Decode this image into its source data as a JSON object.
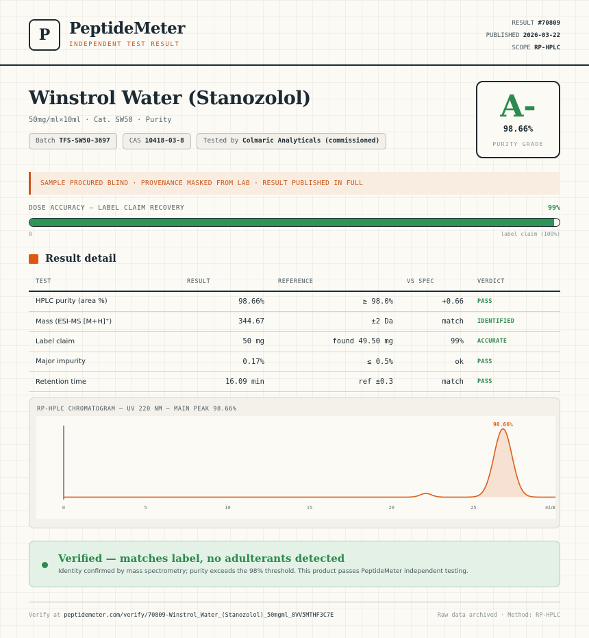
{
  "brand": {
    "logo_letter": "P",
    "name": "PeptideMeter",
    "tagline": "INDEPENDENT TEST RESULT"
  },
  "meta": {
    "result_label": "RESULT",
    "result_value": "#70809",
    "published_label": "PUBLISHED",
    "published_value": "2026-03-22",
    "scope_label": "SCOPE",
    "scope_value": "RP-HPLC"
  },
  "product": {
    "title": "Winstrol Water (Stanozolol)",
    "subtitle": "50mg/ml×10ml · Cat. SW50 · Purity",
    "chips": [
      {
        "label": "Batch",
        "value": "TFS-SW50-3697"
      },
      {
        "label": "CAS",
        "value": "10418-03-8"
      },
      {
        "label": "Tested by",
        "value": "Colmaric Analyticals (commissioned)"
      }
    ]
  },
  "grade": {
    "letter": "A-",
    "value": "98.66%",
    "label": "PURITY GRADE",
    "color": "#2d8a4e"
  },
  "banner": {
    "text": "SAMPLE PROCURED BLIND · PROVENANCE MASKED FROM LAB · RESULT PUBLISHED IN FULL",
    "color": "#c8561b"
  },
  "dose": {
    "label": "DOSE ACCURACY — LABEL CLAIM RECOVERY",
    "percent_text": "99%",
    "fill_fraction": 0.99,
    "min_label": "0",
    "max_label": "label claim (100%)"
  },
  "detail": {
    "title": "Result detail",
    "columns": [
      "TEST",
      "RESULT",
      "REFERENCE",
      "VS SPEC",
      "VERDICT"
    ],
    "rows": [
      {
        "test": "HPLC purity (area %)",
        "result": "98.66%",
        "reference": "≥ 98.0%",
        "vs_spec": "+0.66",
        "verdict": "PASS"
      },
      {
        "test": "Mass (ESI-MS [M+H]⁺)",
        "result": "344.67",
        "reference": "±2 Da",
        "vs_spec": "match",
        "verdict": "IDENTIFIED"
      },
      {
        "test": "Label claim",
        "result": "50 mg",
        "reference": "found 49.50 mg",
        "vs_spec": "99%",
        "verdict": "ACCURATE"
      },
      {
        "test": "Major impurity",
        "result": "0.17%",
        "reference": "≤ 0.5%",
        "vs_spec": "ok",
        "verdict": "PASS"
      },
      {
        "test": "Retention time",
        "result": "16.09 min",
        "reference": "ref ±0.3",
        "vs_spec": "match",
        "verdict": "PASS"
      }
    ]
  },
  "chart_data": {
    "type": "line",
    "title": "RP-HPLC CHROMATOGRAM — UV 220 NM — MAIN PEAK 98.66%",
    "x_ticks": [
      "0",
      "5",
      "10",
      "15",
      "20",
      "25",
      "30"
    ],
    "x_unit_label": "min",
    "xlim": [
      0,
      30
    ],
    "ylim": [
      0,
      100
    ],
    "baseline": 1.5,
    "peaks": [
      {
        "center": 22.1,
        "height": 5,
        "width": 0.35
      },
      {
        "center": 26.8,
        "height": 94,
        "width": 0.55,
        "label": "98.66%"
      }
    ],
    "line_color": "#d9601c",
    "fill_color": "#f7e1d3"
  },
  "verified": {
    "title": "Verified — matches label, no adulterants detected",
    "text": "Identity confirmed by mass spectrometry; purity exceeds the 98% threshold. This product passes PeptideMeter independent testing.",
    "color": "#2d8a4e"
  },
  "footer": {
    "verify_prefix": "Verify at",
    "verify_url": "peptidemeter.com/verify/70809-Winstrol_Water_(Stanozolol)_50mgml_8VV5MTHF3C7E",
    "right_text": "Raw data archived · Method: RP-HPLC"
  }
}
